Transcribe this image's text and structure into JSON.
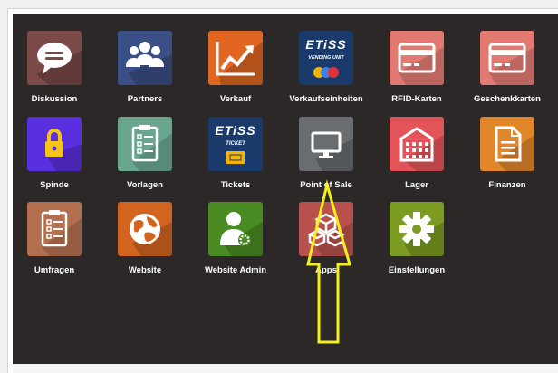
{
  "apps": [
    {
      "label": "Diskussion",
      "icon": "chat-bubble-icon",
      "color": "#7b4a48"
    },
    {
      "label": "Partners",
      "icon": "people-group-icon",
      "color": "#3a4f86"
    },
    {
      "label": "Verkauf",
      "icon": "sales-trend-icon",
      "color": "#e06621"
    },
    {
      "label": "Verkaufseinheiten",
      "icon": "etiss-vending-unit-icon",
      "color": "#1a3a6b"
    },
    {
      "label": "RFID-Karten",
      "icon": "card-icon",
      "color": "#e27a72"
    },
    {
      "label": "Geschenkkarten",
      "icon": "card-icon",
      "color": "#e27a72"
    },
    {
      "label": "Spinde",
      "icon": "padlock-icon",
      "color": "#5a2fe0"
    },
    {
      "label": "Vorlagen",
      "icon": "clipboard-list-icon",
      "color": "#6aa58e"
    },
    {
      "label": "Tickets",
      "icon": "etiss-ticket-icon",
      "color": "#1a3a6b"
    },
    {
      "label": "Point of Sale",
      "icon": "monitor-icon",
      "color": "#6a6d70"
    },
    {
      "label": "Lager",
      "icon": "warehouse-icon",
      "color": "#e5535a"
    },
    {
      "label": "Finanzen",
      "icon": "document-icon",
      "color": "#e2862a"
    },
    {
      "label": "Umfragen",
      "icon": "clipboard-list-icon",
      "color": "#b2704f"
    },
    {
      "label": "Website",
      "icon": "globe-icon",
      "color": "#d2641f"
    },
    {
      "label": "Website Admin",
      "icon": "user-gear-icon",
      "color": "#4a8a22"
    },
    {
      "label": "Apps",
      "icon": "cubes-icon",
      "color": "#b8514d"
    },
    {
      "label": "Einstellungen",
      "icon": "gear-icon",
      "color": "#7b9c20"
    }
  ],
  "etiss": {
    "brand": "ETiSS",
    "vending": "VENDING UNIT",
    "ticket": "TICKET"
  },
  "annotation": {
    "color": "#f4ee19"
  }
}
